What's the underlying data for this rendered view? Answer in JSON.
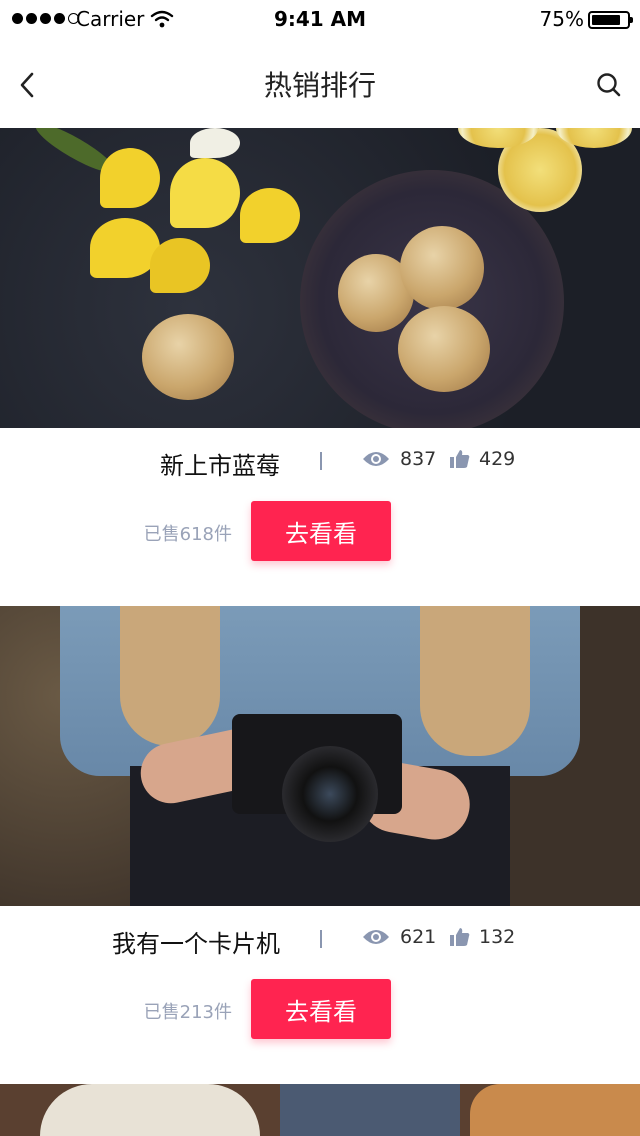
{
  "status_bar": {
    "carrier": "Carrier",
    "time": "9:41 AM",
    "battery": "75%",
    "battery_level": 0.75
  },
  "nav": {
    "title": "热销排行",
    "back_icon": "chevron-left-icon",
    "search_icon": "search-icon"
  },
  "products": [
    {
      "name": "新上市蓝莓",
      "views": "837",
      "likes": "429",
      "sold": "已售618件",
      "button": "去看看"
    },
    {
      "name": "我有一个卡片机",
      "views": "621",
      "likes": "132",
      "sold": "已售213件",
      "button": "去看看"
    }
  ],
  "colors": {
    "accent": "#ff2450",
    "muted": "#9aa3b8",
    "icon": "#8a96b0"
  }
}
